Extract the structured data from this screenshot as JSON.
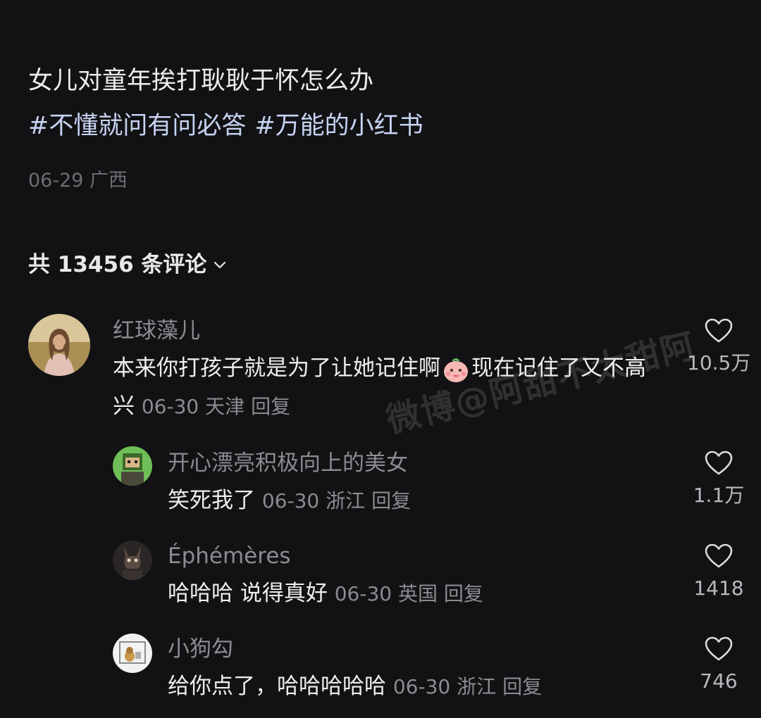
{
  "post": {
    "title": "女儿对童年挨打耿耿于怀怎么办",
    "tags": [
      "#不懂就问有问必答",
      "#万能的小红书"
    ],
    "date": "06-29",
    "location": "广西"
  },
  "comments_header": {
    "label": "共 13456 条评论"
  },
  "watermark": "微博@阿甜不太甜阿",
  "comments": [
    {
      "username": "红球藻儿",
      "text_before_emoji": "本来你打孩子就是为了让她记住啊",
      "emoji": "smiling-face-emoji",
      "text_after_emoji": "现在记住了又不高兴",
      "date": "06-30",
      "location": "天津",
      "reply": "回复",
      "likes": "10.5万"
    },
    {
      "username": "开心漂亮积极向上的美女",
      "text": "笑死我了",
      "date": "06-30",
      "location": "浙江",
      "reply": "回复",
      "likes": "1.1万"
    },
    {
      "username": "Éphémères",
      "text": "哈哈哈 说得真好",
      "date": "06-30",
      "location": "英国",
      "reply": "回复",
      "likes": "1418"
    },
    {
      "username": "小狗勾",
      "text": "给你点了，哈哈哈哈哈",
      "date": "06-30",
      "location": "浙江",
      "reply": "回复",
      "likes": "746"
    }
  ],
  "icons": {
    "like": "heart-outline-icon",
    "expand": "chevron-down-icon"
  },
  "colors": {
    "background": "#121214",
    "tag": "#c6d3f2",
    "meta": "#8b8b90"
  }
}
